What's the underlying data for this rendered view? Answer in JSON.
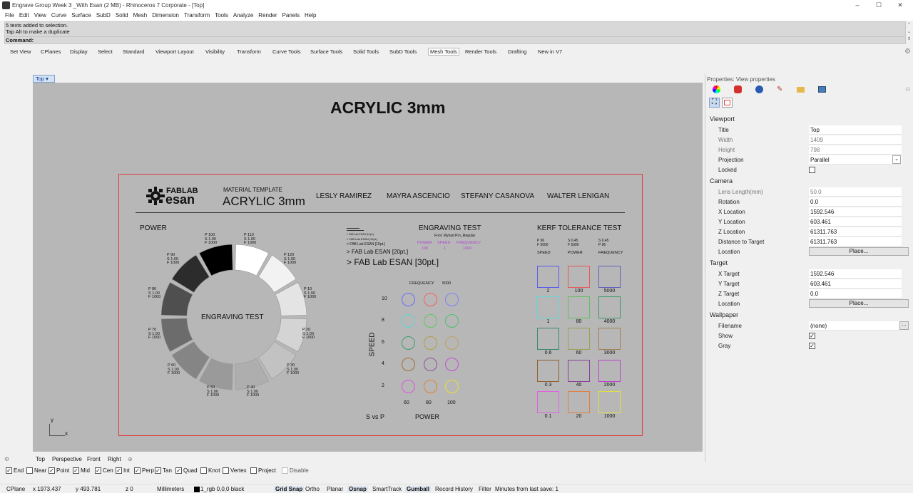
{
  "window": {
    "title": "Engrave Group Week 3 _With Esan (2 MB) - Rhinoceros 7 Corporate - [Top]",
    "minimize": "–",
    "maximize": "☐",
    "close": "✕"
  },
  "menu": [
    "File",
    "Edit",
    "View",
    "Curve",
    "Surface",
    "SubD",
    "Solid",
    "Mesh",
    "Dimension",
    "Transform",
    "Tools",
    "Analyze",
    "Render",
    "Panels",
    "Help"
  ],
  "command": {
    "history": [
      "5 texts added to selection.",
      "Tap Alt to make a duplicate"
    ],
    "prompt": "Command:"
  },
  "tabs": [
    "Set View",
    "CPlanes",
    "Display",
    "Select",
    "Standard",
    "Viewport Layout",
    "Visibility",
    "Transform",
    "Curve Tools",
    "Surface Tools",
    "Solid Tools",
    "SubD Tools",
    "Mesh Tools",
    "Render Tools",
    "Drafting",
    "New in V7"
  ],
  "active_tab": "Mesh Tools",
  "viewport": {
    "label": "Top",
    "main_title": "ACRYLIC 3mm",
    "logo_top": "FABLAB",
    "logo_bottom": "esan",
    "material_template": "MATERIAL TEMPLATE",
    "material_name": "ACRYLIC 3mm",
    "names": [
      "LESLY RAMIREZ",
      "MAYRA ASCENCIO",
      "STEFANY CASANOVA",
      "WALTER LENIGAN"
    ],
    "power_title": "POWER",
    "wheel_center": "ENGRAVING TEST",
    "wheel_labels": [
      "P 100\nS 1.00\nF 1000",
      "P 110\nS 1.00\nF 1000",
      "P 120\nS 1.00\nF 1000",
      "P 10\nS 1.00\nF 1000",
      "P 20\nS 1.00\nF 1000",
      "P 30\nS 1.00\nF 1000",
      "P 40\nS 1.00\nF 1000",
      "P 50\nS 1.00\nF 1000",
      "P 60\nS 1.00\nF 1000",
      "P 70\nS 1.00\nF 1000",
      "P 80\nS 1.00\nF 1000",
      "P 90\nS 1.00\nF 1000"
    ],
    "wheel_fills": [
      "#000000",
      "#ffffff",
      "#f2f2f2",
      "#e4e4e4",
      "#d4d4d4",
      "#c2c2c2",
      "#aeaeae",
      "#9a9a9a",
      "#858585",
      "#6c6c6c",
      "#4f4f4f",
      "#2c2c2c"
    ],
    "engraving_test": {
      "title": "ENGRAVING TEST",
      "font": "Font: Myriad Pro_Regular",
      "lines": [
        "> FAB Lab ESAN [10pt.]",
        "> FAB Lab ESAN [12pt.]",
        "> FAB Lab ESAN [15pt.]",
        "> FAB Lab ESAN [20pt.]",
        "> FAB Lab ESAN [30pt.]"
      ],
      "param_headers": [
        "POWER",
        "SPEED",
        "FREQUENCY"
      ],
      "param_values": [
        "100",
        "1",
        "1000"
      ]
    },
    "grid": {
      "freq_label": "FREQUENCY",
      "freq_value": "5000",
      "speed_label": "SPEED",
      "speeds": [
        "10",
        "8",
        "6",
        "4",
        "2"
      ],
      "powers": [
        "60",
        "80",
        "100"
      ],
      "svp": "S vs P",
      "power_label": "POWER",
      "colors": [
        [
          "#6a6aff",
          "#ff5a5a",
          "#7f7fff"
        ],
        [
          "#5cd6d6",
          "#5ccc5c",
          "#4cc06c"
        ],
        [
          "#3f9f6f",
          "#b0a040",
          "#c0a060"
        ],
        [
          "#a07030",
          "#8a50a0",
          "#c050d0"
        ],
        [
          "#e050e0",
          "#e08030",
          "#e8e030"
        ]
      ]
    },
    "kerf": {
      "title": "KERF TOLERANCE TEST",
      "p1": "P 96\nF 5000",
      "p2": "S 0.45\nF 5000",
      "p3": "S 0.45\nP 96",
      "headers": [
        "SPEED",
        "POWER",
        "FREQUENCY"
      ],
      "rows": [
        [
          "2",
          "100",
          "5000"
        ],
        [
          "1",
          "80",
          "4000"
        ],
        [
          "0.6",
          "60",
          "3000"
        ],
        [
          "0.3",
          "40",
          "2000"
        ],
        [
          "0.1",
          "20",
          "1000"
        ]
      ],
      "colors": [
        [
          "#5a5aee",
          "#e85a5a",
          "#6060c0"
        ],
        [
          "#60d8d8",
          "#60c060",
          "#3a9a6a"
        ],
        [
          "#3a8a6a",
          "#a0a050",
          "#a08050"
        ],
        [
          "#906030",
          "#8a40a0",
          "#c040d0"
        ],
        [
          "#e060e0",
          "#e08040",
          "#e0e040"
        ]
      ]
    },
    "axis_y": "y",
    "axis_x": "x"
  },
  "viewport_tabs": [
    "Top",
    "Perspective",
    "Front",
    "Right"
  ],
  "osnap": [
    {
      "label": "End",
      "checked": true
    },
    {
      "label": "Near",
      "checked": false
    },
    {
      "label": "Point",
      "checked": true
    },
    {
      "label": "Mid",
      "checked": true
    },
    {
      "label": "Cen",
      "checked": true
    },
    {
      "label": "Int",
      "checked": true
    },
    {
      "label": "Perp",
      "checked": true
    },
    {
      "label": "Tan",
      "checked": true
    },
    {
      "label": "Quad",
      "checked": true
    },
    {
      "label": "Knot",
      "checked": false
    },
    {
      "label": "Vertex",
      "checked": false
    },
    {
      "label": "Project",
      "checked": false
    },
    {
      "label": "Disable",
      "checked": false
    }
  ],
  "status": {
    "cplane": "CPlane",
    "x": "x 1973.437",
    "y": "y 493.781",
    "z": "z 0",
    "units": "Millimeters",
    "layer": "1_rgb 0,0,0 black",
    "grid_snap": "Grid Snap",
    "ortho": "Ortho",
    "planar": "Planar",
    "osnap": "Osnap",
    "smarttrack": "SmartTrack",
    "gumball": "Gumball",
    "record": "Record History",
    "filter": "Filter",
    "save": "Minutes from last save: 1"
  },
  "properties": {
    "header": "Properties: View properties",
    "viewport_section": "Viewport",
    "camera_section": "Camera",
    "target_section": "Target",
    "wallpaper_section": "Wallpaper",
    "title_k": "Title",
    "title_v": "Top",
    "width_k": "Width",
    "width_v": "1409",
    "height_k": "Height",
    "height_v": "798",
    "proj_k": "Projection",
    "proj_v": "Parallel",
    "locked_k": "Locked",
    "lens_k": "Lens Length(mm)",
    "lens_v": "50.0",
    "rot_k": "Rotation",
    "rot_v": "0.0",
    "xloc_k": "X Location",
    "xloc_v": "1592.546",
    "yloc_k": "Y Location",
    "yloc_v": "603.461",
    "zloc_k": "Z Location",
    "zloc_v": "61311.763",
    "dist_k": "Distance to Target",
    "dist_v": "61311.763",
    "loc_k": "Location",
    "place": "Place...",
    "xt_k": "X Target",
    "xt_v": "1592.546",
    "yt_k": "Y Target",
    "yt_v": "603.461",
    "zt_k": "Z Target",
    "zt_v": "0.0",
    "tloc_k": "Location",
    "file_k": "Filename",
    "file_v": "(none)",
    "show_k": "Show",
    "gray_k": "Gray",
    "browse": "..."
  }
}
